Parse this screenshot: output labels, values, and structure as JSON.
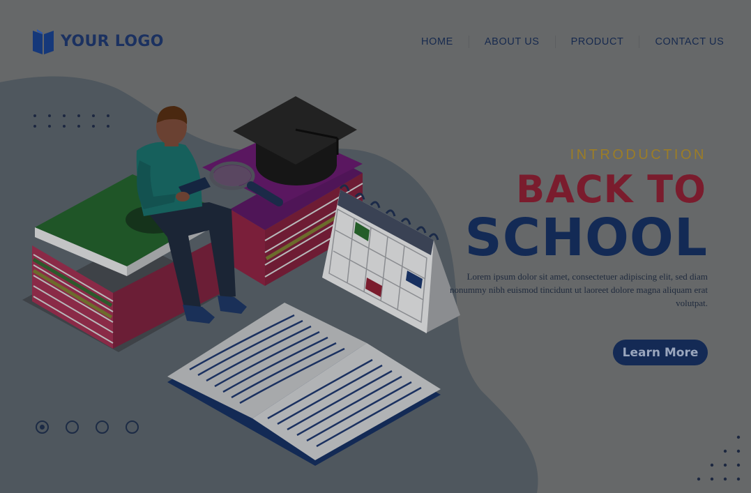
{
  "logo": {
    "text": "YOUR LOGO",
    "icon": "book-icon"
  },
  "nav": {
    "items": [
      {
        "label": "HOME"
      },
      {
        "label": "ABOUT US"
      },
      {
        "label": "PRODUCT"
      },
      {
        "label": "CONTACT US"
      }
    ]
  },
  "hero": {
    "eyebrow": "INTRODUCTION",
    "title_line1": "BACK TO",
    "title_line2": "SCHOOL",
    "description": "Lorem ipsum dolor sit amet, consectetuer adipiscing elit, sed diam nonummy nibh euismod tincidunt ut laoreet dolore magna aliquam erat volutpat.",
    "cta_label": "Learn More"
  },
  "pagination": {
    "total": 4,
    "active": 1
  },
  "illustration": {
    "elements": [
      "student-reading",
      "book-stack",
      "graduation-cap-icon",
      "magnifying-glass-icon",
      "desk-calendar",
      "open-book"
    ]
  },
  "colors": {
    "background": "#666869",
    "blob": "#4f575e",
    "navy": "#132a55",
    "crimson": "#7a1c2d",
    "gold": "#9c7d26"
  }
}
